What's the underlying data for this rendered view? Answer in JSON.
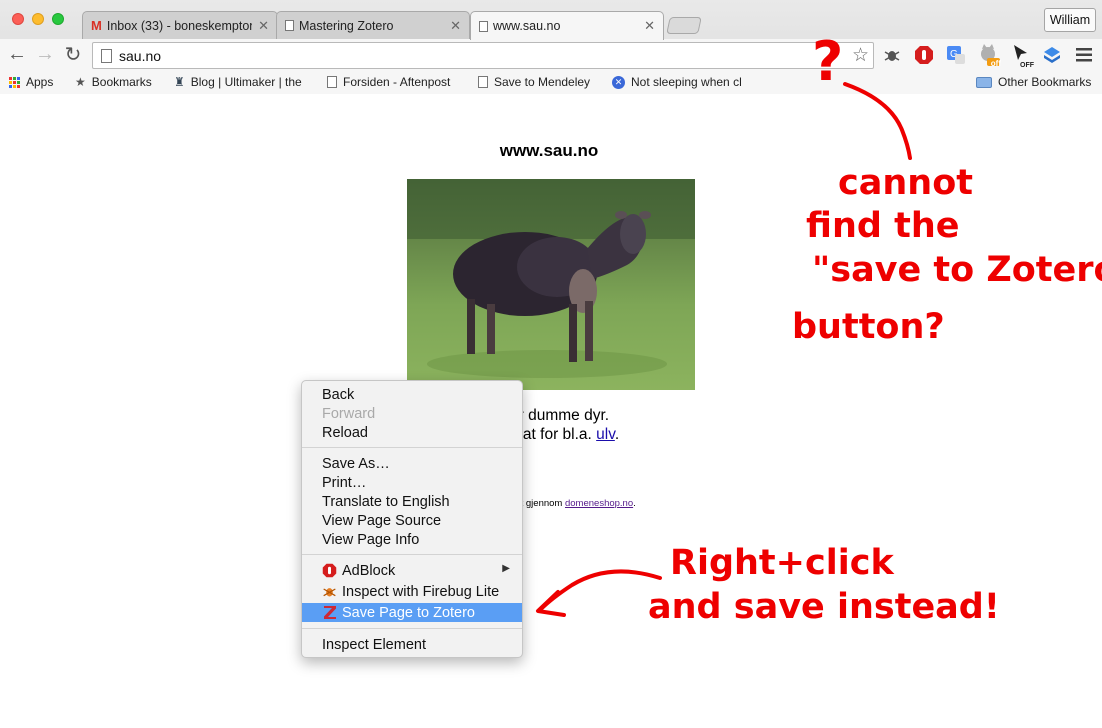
{
  "window": {
    "profile_name": "William"
  },
  "tabs": [
    {
      "label": "Inbox (33) - boneskempton",
      "icon": "gmail-icon",
      "active": false
    },
    {
      "label": "Mastering Zotero",
      "icon": "page-icon",
      "active": false
    },
    {
      "label": "www.sau.no",
      "icon": "page-icon",
      "active": true
    }
  ],
  "toolbar": {
    "url": "sau.no",
    "extensions": [
      "firebug-icon",
      "adblock-icon",
      "translate-icon",
      "cat-extension-icon",
      "cursor-extension-icon",
      "dropbox-icon",
      "menu-icon"
    ],
    "badge_off_1": "off",
    "badge_off_2": "OFF"
  },
  "bookmarks": {
    "apps": "Apps",
    "items": [
      {
        "label": "Bookmarks",
        "icon": "star-icon"
      },
      {
        "label": "Blog | Ultimaker | the",
        "icon": "ultimaker-icon"
      },
      {
        "label": "Forsiden - Aftenpost",
        "icon": "page-icon"
      },
      {
        "label": "Save to Mendeley",
        "icon": "page-icon"
      },
      {
        "label": "Not sleeping when cl",
        "icon": "blocked-icon"
      }
    ],
    "other": "Other Bookmarks"
  },
  "page": {
    "title": "www.sau.no",
    "line1": "er dumme dyr.",
    "line2_prefix": "mat for bl.a. ",
    "line2_link": "ulv",
    "line2_suffix": ".",
    "footer_prefix": "rert gjennom ",
    "footer_link": "domeneshop.no",
    "footer_suffix": "."
  },
  "context_menu": {
    "back": "Back",
    "forward": "Forward",
    "reload": "Reload",
    "save_as": "Save As…",
    "print": "Print…",
    "translate": "Translate to English",
    "view_source": "View Page Source",
    "view_info": "View Page Info",
    "adblock": "AdBlock",
    "firebug": "Inspect with Firebug Lite",
    "zotero": "Save Page to Zotero",
    "inspect": "Inspect Element"
  },
  "annotations": {
    "question_mark": "?",
    "note1_line1": "cannot",
    "note1_line2": "find the",
    "note1_line3": "\"save to Zotero\"",
    "note1_line4": "button?",
    "note2_line1": "Right+click",
    "note2_line2": "and save instead!",
    "color": "#ee0000"
  },
  "colors": {
    "menu_highlight": "#5a9ef4",
    "link": "#1a0dab"
  }
}
